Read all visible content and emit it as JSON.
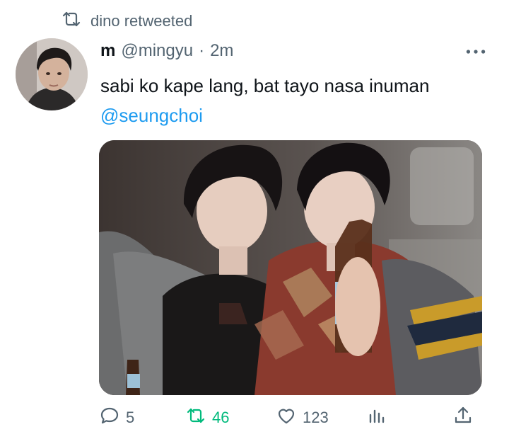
{
  "retweet": {
    "icon": "retweet-icon",
    "text": "dino retweeted"
  },
  "tweet": {
    "name": "m",
    "handle": "@mingyu",
    "separator": "·",
    "time": "2m",
    "text": "sabi ko kape lang, bat tayo nasa inuman",
    "mention": "@seungchoi"
  },
  "actions": {
    "reply_count": "5",
    "retweet_count": "46",
    "like_count": "123"
  },
  "colors": {
    "secondary_text": "#536471",
    "mention": "#1d9bf0",
    "retweeted_green": "#00ba7c"
  }
}
